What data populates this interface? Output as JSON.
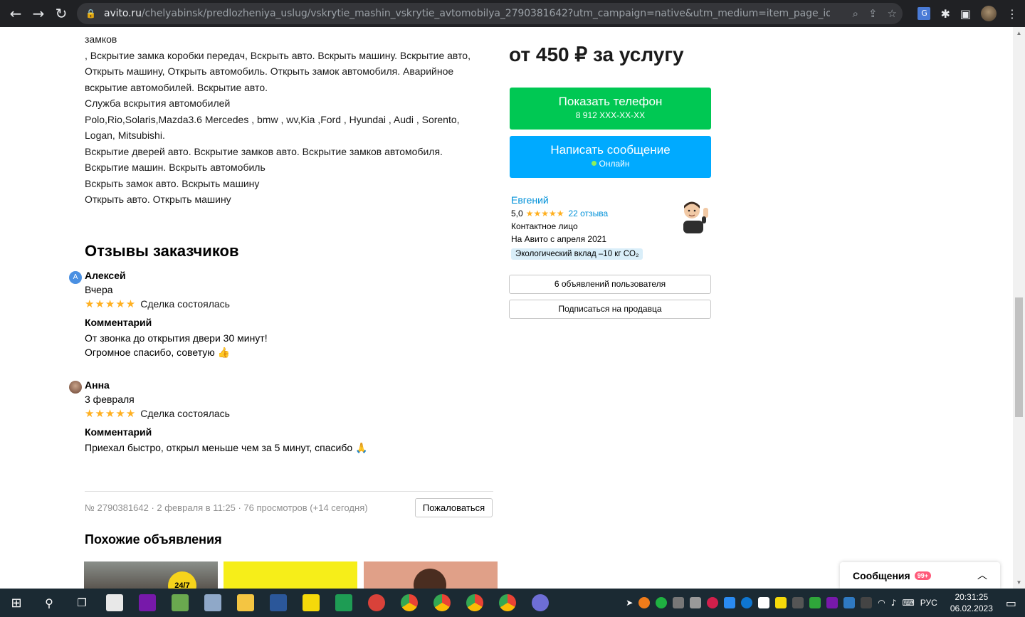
{
  "browser": {
    "url_host": "avito.ru",
    "url_path": "/chelyabinsk/predlozheniya_uslug/vskrytie_mashin_vskrytie_avtomobilya_2790381642?utm_campaign=native&utm_medium=item_page_ios&utm_source=so..."
  },
  "description": {
    "lines": [
      "замков",
      ", Вскрытие замка коробки передач, Вскрыть авто. Вскрыть машину. Вскрытие авто,",
      "Открыть машину, Открыть автомобиль. Открыть замок автомобиля. Аварийное",
      "вскрытие автомобилей. Вскрытие авто.",
      "Служба вскрытия автомобилей",
      "Polo,Rio,Solaris,Mazda3.6 Mercedes , bmw , wv,Kia ,Ford , Hyundai , Audi , Sorento,",
      "Logan, Mitsubishi.",
      "Вскрытие дверей авто. Вскрытие замков авто. Вскрытие замков автомобиля.",
      "Вскрытие машин. Вскрыть автомобиль",
      "Вскрыть замок авто. Вскрыть машину",
      "Открыть авто. Открыть машину"
    ]
  },
  "reviews": {
    "title": "Отзывы заказчиков",
    "items": [
      {
        "avatar_letter": "А",
        "name": "Алексей",
        "date": "Вчера",
        "stars": "★★★★★",
        "deal": "Сделка состоялась",
        "comment_label": "Комментарий",
        "comment_line1": "От звонка до открытия двери 30 минут!",
        "comment_line2": "Огромное спасибо, советую",
        "emoji": "👍"
      },
      {
        "avatar_letter": "",
        "name": "Анна",
        "date": "3 февраля",
        "stars": "★★★★★",
        "deal": "Сделка состоялась",
        "comment_label": "Комментарий",
        "comment_line1": "Приехал быстро, открыл меньше чем за 5 минут, спасибо",
        "emoji": "🙏"
      }
    ]
  },
  "footer_meta": {
    "text": "№ 2790381642 · 2 февраля в 11:25 · 76 просмотров (+14 сегодня)",
    "complain_label": "Пожаловаться"
  },
  "similar": {
    "title": "Похожие объявления",
    "badge": "24/7"
  },
  "sidebar": {
    "price": "от 450 ₽ за услугу",
    "phone_button": "Показать телефон",
    "phone_masked": "8 912 XXX-XX-XX",
    "message_button": "Написать сообщение",
    "online_status": "Онлайн",
    "seller": {
      "name": "Евгений",
      "rating": "5,0",
      "stars": "★★★★★",
      "reviews_link": "22 отзыва",
      "role": "Контактное лицо",
      "since": "На Авито с апреля 2021",
      "eco": "Экологический вклад –10 кг CO₂"
    },
    "ads_button": "6 объявлений пользователя",
    "subscribe_button": "Подписаться на продавца"
  },
  "messages_widget": {
    "title": "Сообщения",
    "badge": "99+"
  },
  "taskbar": {
    "lang": "РУС",
    "time": "20:31:25",
    "date": "06.02.2023"
  },
  "colors": {
    "phone_button": "#00c853",
    "message_button": "#00aaff",
    "link": "#0091d9",
    "stars": "#ffb021"
  }
}
